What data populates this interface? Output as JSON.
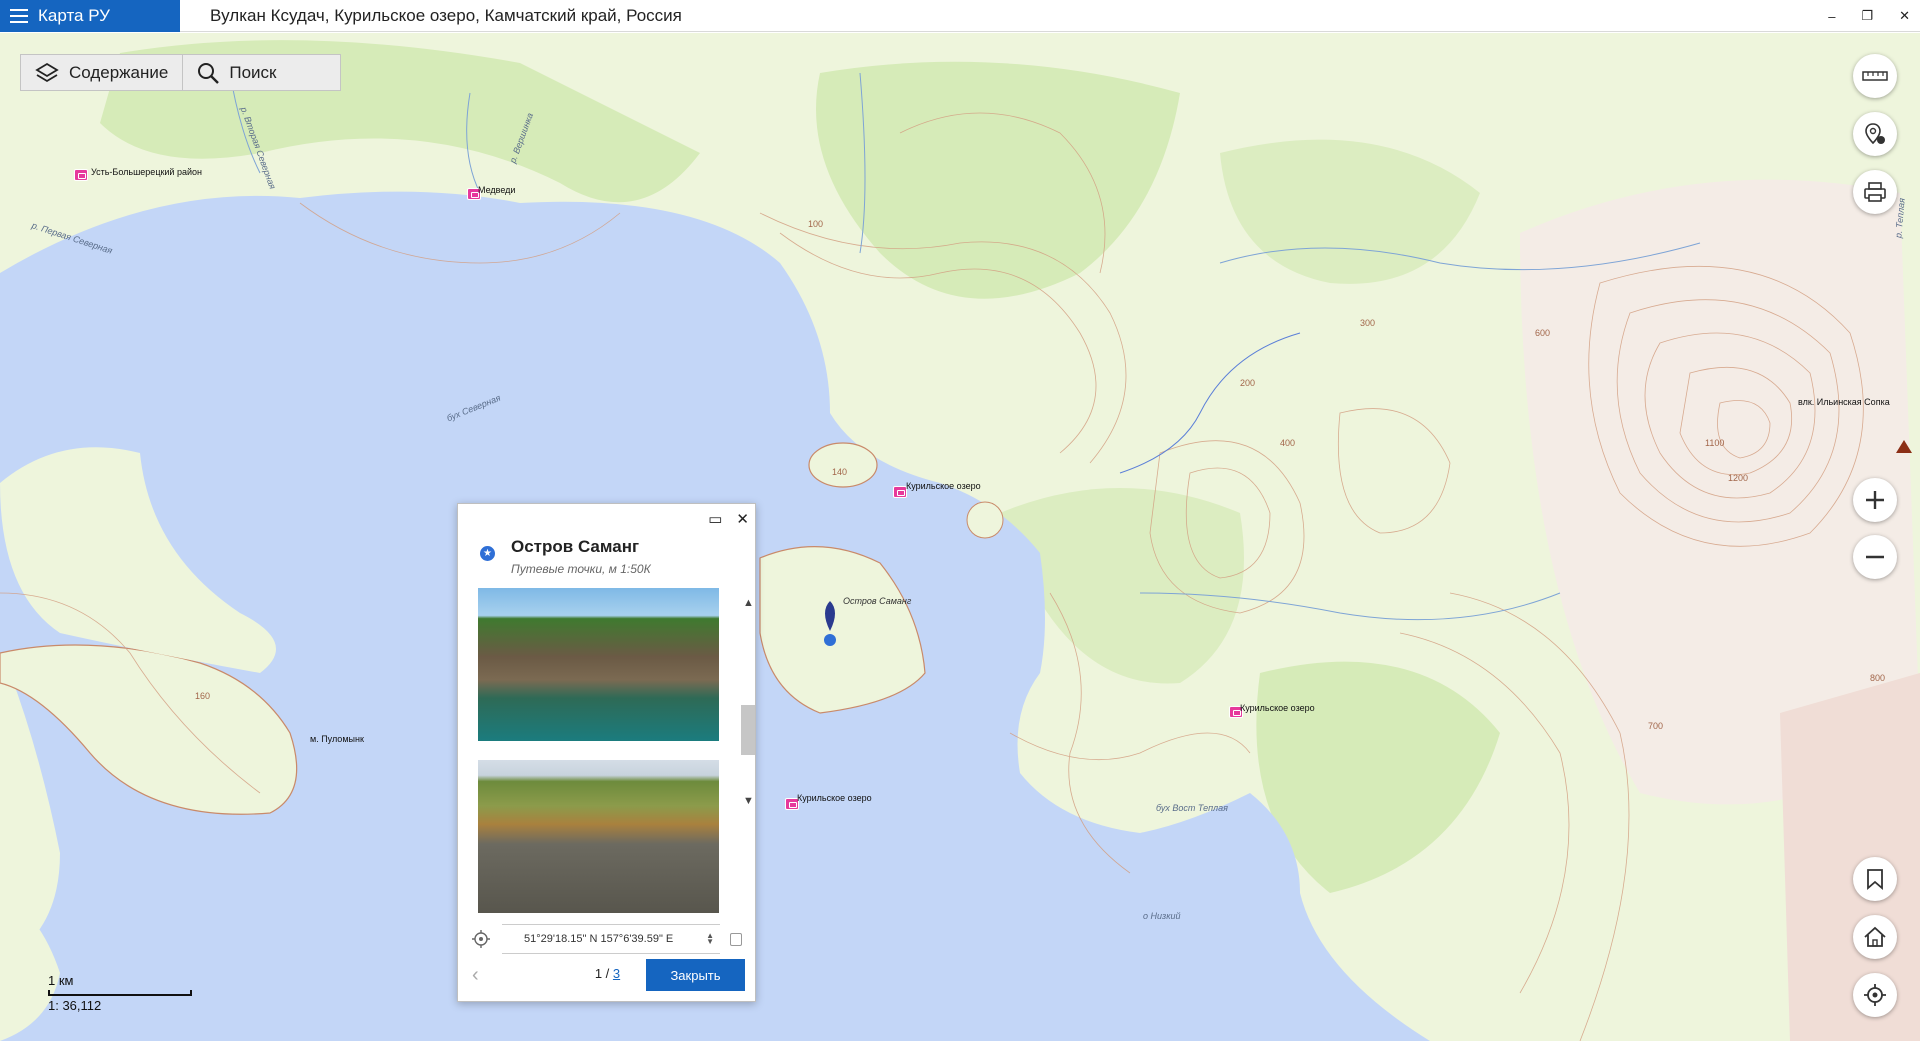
{
  "app": {
    "title": "Карта РУ"
  },
  "window": {
    "title": "Вулкан Ксудач, Курильское озеро, Камчатский край, Россия",
    "minimize": "–",
    "restore": "❐",
    "close": "✕"
  },
  "toolbar": {
    "contents_label": "Содержание",
    "search_label": "Поиск"
  },
  "map_labels": {
    "ust_bolsheretsky": "Усть-Большерецкий район",
    "medvedi": "Медведи",
    "kuril_lake_1": "Курильское озеро",
    "kuril_lake_2": "Курильское озеро",
    "kuril_lake_3": "Курильское озеро",
    "samang_island": "Остров Саманг",
    "cape_pulomynk": "м. Пуломынк",
    "bay_severnaya": "бух Северная",
    "bay_vost_teplaya": "бух Вост Теплая",
    "isl_nizkiy": "о Низкий",
    "volcano": "влк. Ильинская Сопка",
    "river_pervaya_severnaya": "р. Первая Северная",
    "river_vtoraya_severnaya": "р. Вторая Северная",
    "river_vershinka": "р. Вершинка",
    "river_right": "р. Теплая"
  },
  "contours": {
    "c1": "100",
    "c2": "140",
    "c3": "160",
    "c4": "200",
    "c5": "300",
    "c6": "400",
    "c7": "600",
    "c8": "700",
    "c9": "800",
    "c10": "1100",
    "c11": "1200"
  },
  "scale": {
    "distance": "1 км",
    "ratio": "1: 36,112"
  },
  "popup": {
    "title": "Остров Саманг",
    "subtitle": "Путевые точки, м 1:50К",
    "coordinates": "51°29'18.15\" N 157°6'39.59\" E",
    "page_current": "1 /",
    "page_total": "3",
    "close_label": "Закрыть",
    "maximize": "▭",
    "close_x": "✕"
  },
  "colors": {
    "accent": "#1565c0",
    "water": "#c3d6f7",
    "land": "#eef5dc",
    "forest": "#d6ebb8",
    "contour": "#c98a6a",
    "poi": "#e6399b"
  }
}
